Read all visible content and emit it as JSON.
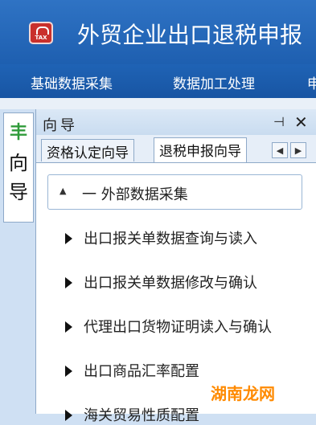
{
  "window": {
    "title": "外贸企业出口退税申报",
    "app_icon_text": "TAX",
    "menu": [
      "基础数据采集",
      "数据加工处理",
      "申"
    ]
  },
  "side_tab": {
    "icon": "引导",
    "label": "向导"
  },
  "panel": {
    "title": "向导",
    "pin_symbol": "⊣",
    "close_symbol": "✕",
    "tabs": [
      "资格认定向导",
      "退税申报向导"
    ],
    "active_tab": "退税申报向导",
    "scroll_left": "◀",
    "scroll_right": "▶"
  },
  "content": {
    "group": {
      "arrow": "▲",
      "label": "一  外部数据采集"
    },
    "items": [
      "出口报关单数据查询与读入",
      "出口报关单数据修改与确认",
      "代理出口货物证明读入与确认",
      "出口商品汇率配置",
      "海关贸易性质配置"
    ]
  },
  "watermark": "湖南龙网"
}
